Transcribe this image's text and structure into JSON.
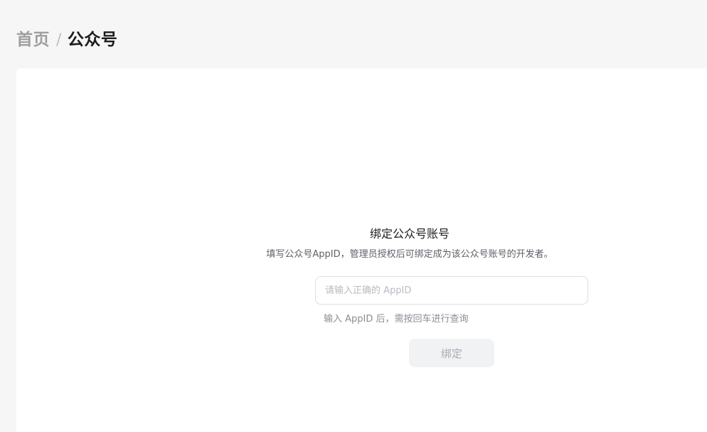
{
  "breadcrumb": {
    "home": "首页",
    "separator": "/",
    "current": "公众号"
  },
  "bind": {
    "title": "绑定公众号账号",
    "description": "填写公众号AppID，管理员授权后可绑定成为该公众号账号的开发者。",
    "input": {
      "value": "",
      "placeholder": "请输入正确的 AppID"
    },
    "hint": "输入 AppID 后，需按回车进行查询",
    "button_label": "绑定",
    "button_disabled": true
  },
  "colors": {
    "page_background": "#f6f6f6",
    "card_background": "#ffffff",
    "button_disabled_background": "#f1f2f4",
    "button_disabled_text": "#a9acb3"
  }
}
